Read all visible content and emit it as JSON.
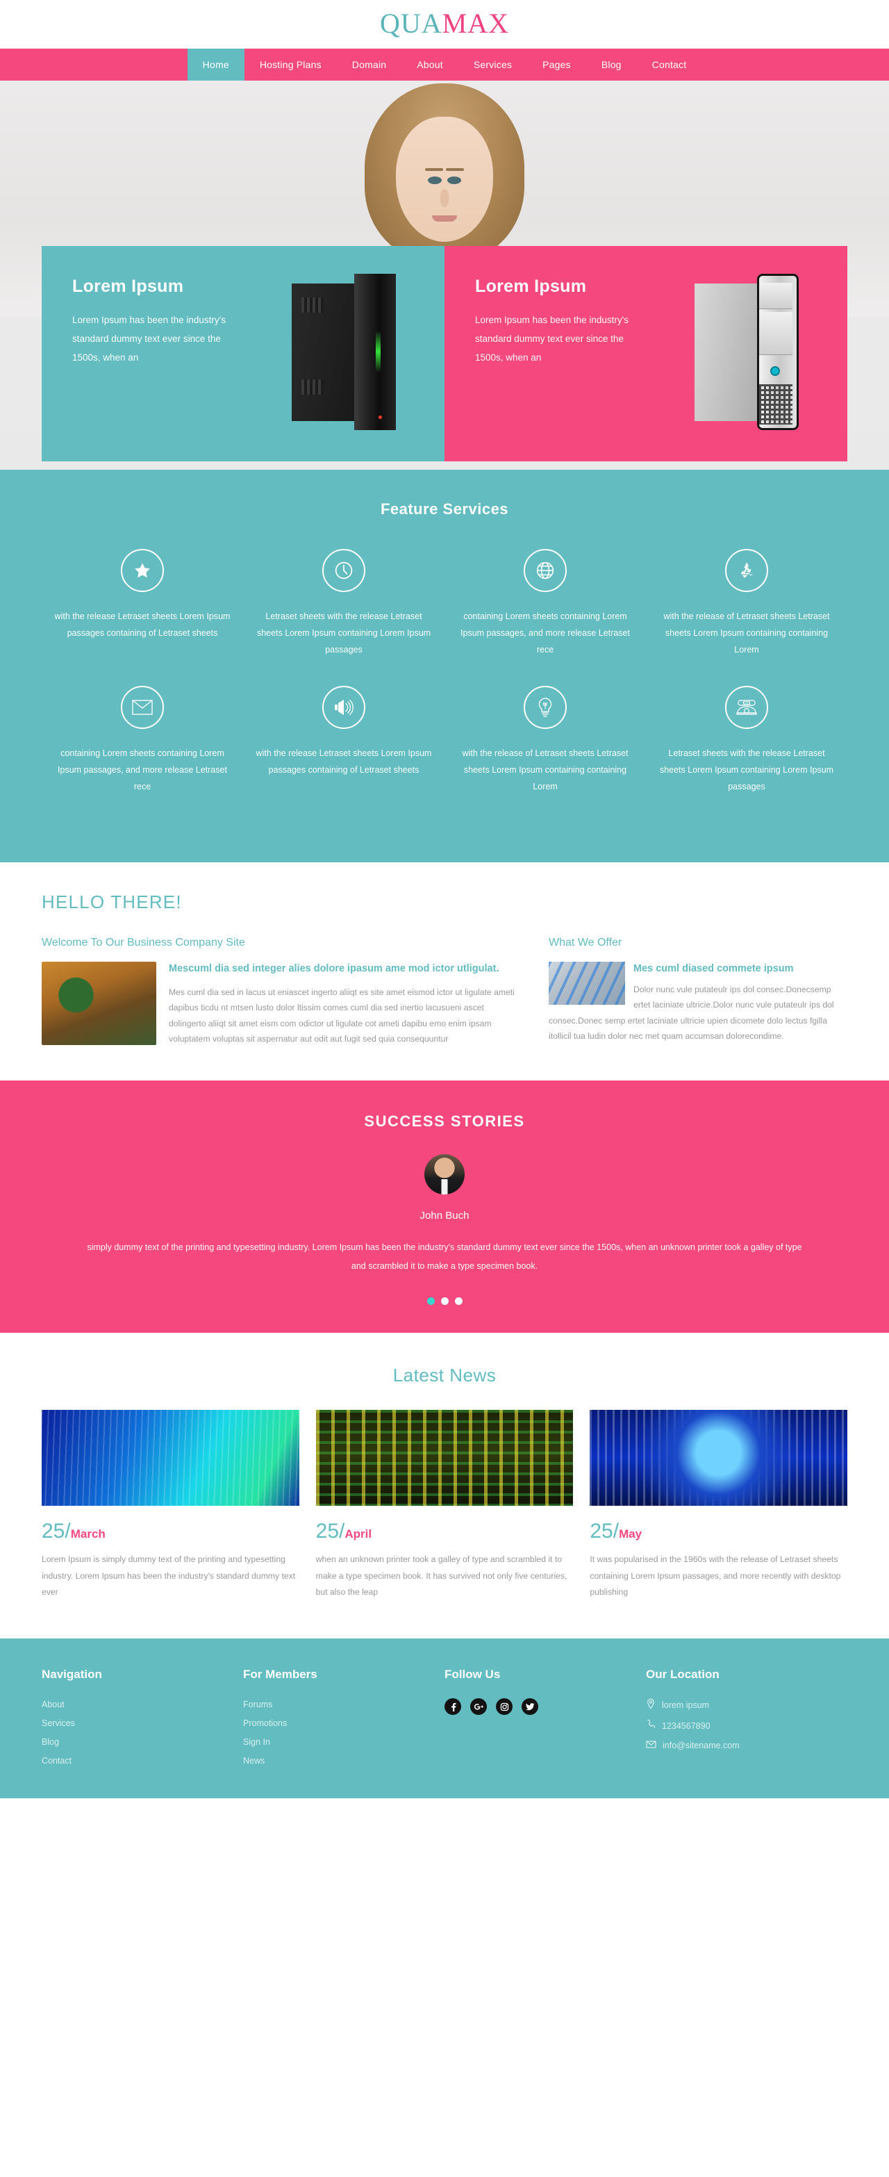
{
  "logo": {
    "part1": "QUA",
    "part2": "MAX"
  },
  "nav": {
    "items": [
      {
        "label": "Home",
        "active": true
      },
      {
        "label": "Hosting Plans",
        "active": false
      },
      {
        "label": "Domain",
        "active": false
      },
      {
        "label": "About",
        "active": false
      },
      {
        "label": "Services",
        "active": false
      },
      {
        "label": "Pages",
        "active": false
      },
      {
        "label": "Blog",
        "active": false
      },
      {
        "label": "Contact",
        "active": false
      }
    ]
  },
  "hero": {
    "boxes": [
      {
        "title": "Lorem Ipsum",
        "text": "Lorem Ipsum has been the industry's standard dummy text ever since the 1500s, when an",
        "theme": "teal",
        "image": "black-server-tower"
      },
      {
        "title": "Lorem Ipsum",
        "text": "Lorem Ipsum has been the industry's standard dummy text ever since the 1500s, when an",
        "theme": "pink",
        "image": "silver-desktop-tower"
      }
    ]
  },
  "features": {
    "title": "Feature Services",
    "items": [
      {
        "icon": "star-icon",
        "text": "with the release Letraset sheets Lorem Ipsum passages containing of Letraset sheets"
      },
      {
        "icon": "clock-icon",
        "text": "Letraset sheets with the release Letraset sheets Lorem Ipsum containing Lorem Ipsum passages"
      },
      {
        "icon": "globe-icon",
        "text": "containing Lorem sheets containing Lorem Ipsum passages, and more release Letraset rece"
      },
      {
        "icon": "recycle-icon",
        "text": "with the release of Letraset sheets Letraset sheets Lorem Ipsum containing containing Lorem"
      },
      {
        "icon": "envelope-icon",
        "text": "containing Lorem sheets containing Lorem Ipsum passages, and more release Letraset rece"
      },
      {
        "icon": "megaphone-icon",
        "text": "with the release Letraset sheets Lorem Ipsum passages containing of Letraset sheets"
      },
      {
        "icon": "lightbulb-icon",
        "text": "with the release of Letraset sheets Letraset sheets Lorem Ipsum containing containing Lorem"
      },
      {
        "icon": "telephone-icon",
        "text": "Letraset sheets with the release Letraset sheets Lorem Ipsum containing Lorem Ipsum passages"
      }
    ]
  },
  "hello": {
    "heading": "HELLO THERE!",
    "left": {
      "subheading": "Welcome To Our Business Company Site",
      "image": "chef-cooking-photo",
      "title": "Mescuml dia sed integer alies dolore ipasum ame mod ictor utligulat.",
      "body": "Mes cuml dia sed in lacus ut eniascet ingerto aliiqt es site amet eismod ictor ut ligulate ameti dapibus ticdu nt mtsen lusto dolor ltissim comes cuml dia sed inertio lacusueni ascet dolingerto aliiqt sit amet eism com odictor ut ligulate cot ameti dapibu emo enim ipsam voluptatem voluptas sit aspernatur aut odit aut fugit sed quia consequuntur"
    },
    "right": {
      "subheading": "What We Offer",
      "image": "datacenter-photo",
      "title": "Mes cuml diased commete ipsum",
      "body": "Dolor nunc vule putateulr ips dol consec.Donecsemp ertet laciniate ultricie.Dolor nunc vule putateulr ips dol consec.Donec semp ertet laciniate ultricie upien dicomete dolo lectus fgilla itollicil tua ludin dolor nec met quam accumsan dolorecondime."
    }
  },
  "success": {
    "title": "SUCCESS STORIES",
    "avatar": "man-in-suit-photo",
    "name": "John Buch",
    "quote": "simply dummy text of the printing and typesetting industry. Lorem Ipsum has been the industry's standard dummy text ever since the 1500s, when an unknown printer took a galley of type and scrambled it to make a type specimen book.",
    "dots": [
      {
        "active": true
      },
      {
        "active": false
      },
      {
        "active": false
      }
    ]
  },
  "news": {
    "title": "Latest News",
    "items": [
      {
        "image": "binary-code-blue-green",
        "day": "25",
        "month": "March",
        "text": "Lorem Ipsum is simply dummy text of the printing and typesetting industry. Lorem Ipsum has been the industry's standard dummy text ever"
      },
      {
        "image": "server-room-lights",
        "day": "25",
        "month": "April",
        "text": "when an unknown printer took a galley of type and scrambled it to make a type specimen book. It has survived not only five centuries, but also the leap"
      },
      {
        "image": "globe-binary-blue",
        "day": "25",
        "month": "May",
        "text": "It was popularised in the 1960s with the release of Letraset sheets containing Lorem Ipsum passages, and more recently with desktop publishing"
      }
    ]
  },
  "footer": {
    "navigation": {
      "title": "Navigation",
      "links": [
        "About",
        "Services",
        "Blog",
        "Contact"
      ]
    },
    "members": {
      "title": "For Members",
      "links": [
        "Forums",
        "Promotions",
        "Sign In",
        "News"
      ]
    },
    "follow": {
      "title": "Follow Us",
      "socials": [
        "facebook-icon",
        "google-plus-icon",
        "instagram-icon",
        "twitter-icon"
      ]
    },
    "location": {
      "title": "Our Location",
      "rows": [
        {
          "icon": "map-pin-icon",
          "text": "lorem ipsum"
        },
        {
          "icon": "phone-icon",
          "text": "1234567890"
        },
        {
          "icon": "mail-icon",
          "text": "info@sitename.com"
        }
      ]
    }
  },
  "colors": {
    "teal": "#62bcc0",
    "pink": "#f5487f",
    "text_gray": "#9a9a9a",
    "dot_active": "#38d6cf"
  }
}
